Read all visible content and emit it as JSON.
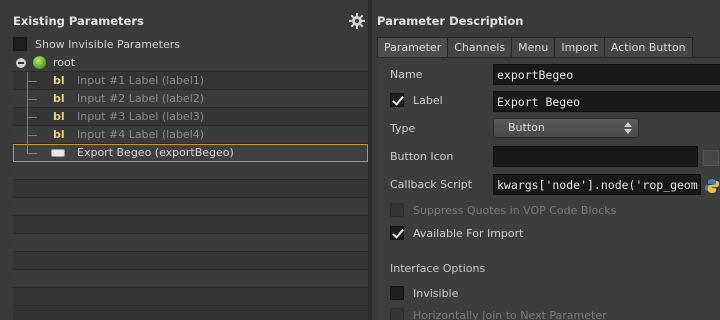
{
  "left_panel": {
    "title": "Existing Parameters",
    "show_invisible_label": "Show Invisible Parameters",
    "root_label": "root",
    "parameters": [
      {
        "label": "Input #1 Label (label1)",
        "icon": "bl"
      },
      {
        "label": "Input #2 Label (label2)",
        "icon": "bl"
      },
      {
        "label": "Input #3 Label (label3)",
        "icon": "bl"
      },
      {
        "label": "Input #4 Label (label4)",
        "icon": "bl"
      },
      {
        "label": "Export Begeo (exportBegeo)",
        "icon": "button-icon"
      }
    ]
  },
  "right_panel": {
    "title": "Parameter Description",
    "tabs": [
      "Parameter",
      "Channels",
      "Menu",
      "Import",
      "Action Button"
    ],
    "fields": {
      "name_label": "Name",
      "name_value": "exportBegeo",
      "label_label": "Label",
      "label_value": "Export Begeo",
      "type_label": "Type",
      "type_value": "Button",
      "button_icon_label": "Button Icon",
      "button_icon_value": "",
      "callback_label": "Callback Script",
      "callback_value": "kwargs['node'].node('rop_geom",
      "suppress_quotes_label": "Suppress Quotes in VOP Code Blocks",
      "available_import_label": "Available For Import",
      "interface_options_label": "Interface Options",
      "invisible_label": "Invisible",
      "horizontally_join_label": "Horizontally Join to Next Parameter"
    }
  },
  "colors": {
    "selection_outline": "#c79b2b",
    "label_icon": "#e9d27a",
    "globe": "#6ab42a"
  }
}
